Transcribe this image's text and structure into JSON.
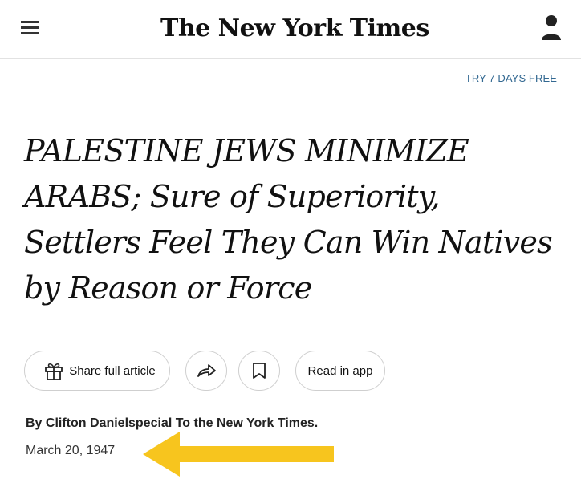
{
  "header": {
    "logo_text": "The New York Times",
    "menu_icon": "hamburger-menu-icon",
    "account_icon": "account-user-icon"
  },
  "promo": {
    "try_free": "TRY 7 DAYS FREE"
  },
  "article": {
    "headline": "PALESTINE JEWS MINIMIZE ARABS; Sure of Superiority, Settlers Feel They Can Win Natives by Reason or Force",
    "byline": "By Clifton Danielspecial To the New York Times.",
    "date": "March 20, 1947"
  },
  "actions": {
    "share_label": "Share full article",
    "read_in_app_label": "Read in app",
    "share_icon": "gift-icon",
    "forward_icon": "forward-arrow-icon",
    "bookmark_icon": "bookmark-icon"
  },
  "colors": {
    "link_blue": "#326891",
    "annotation_arrow": "#f7c51e"
  }
}
